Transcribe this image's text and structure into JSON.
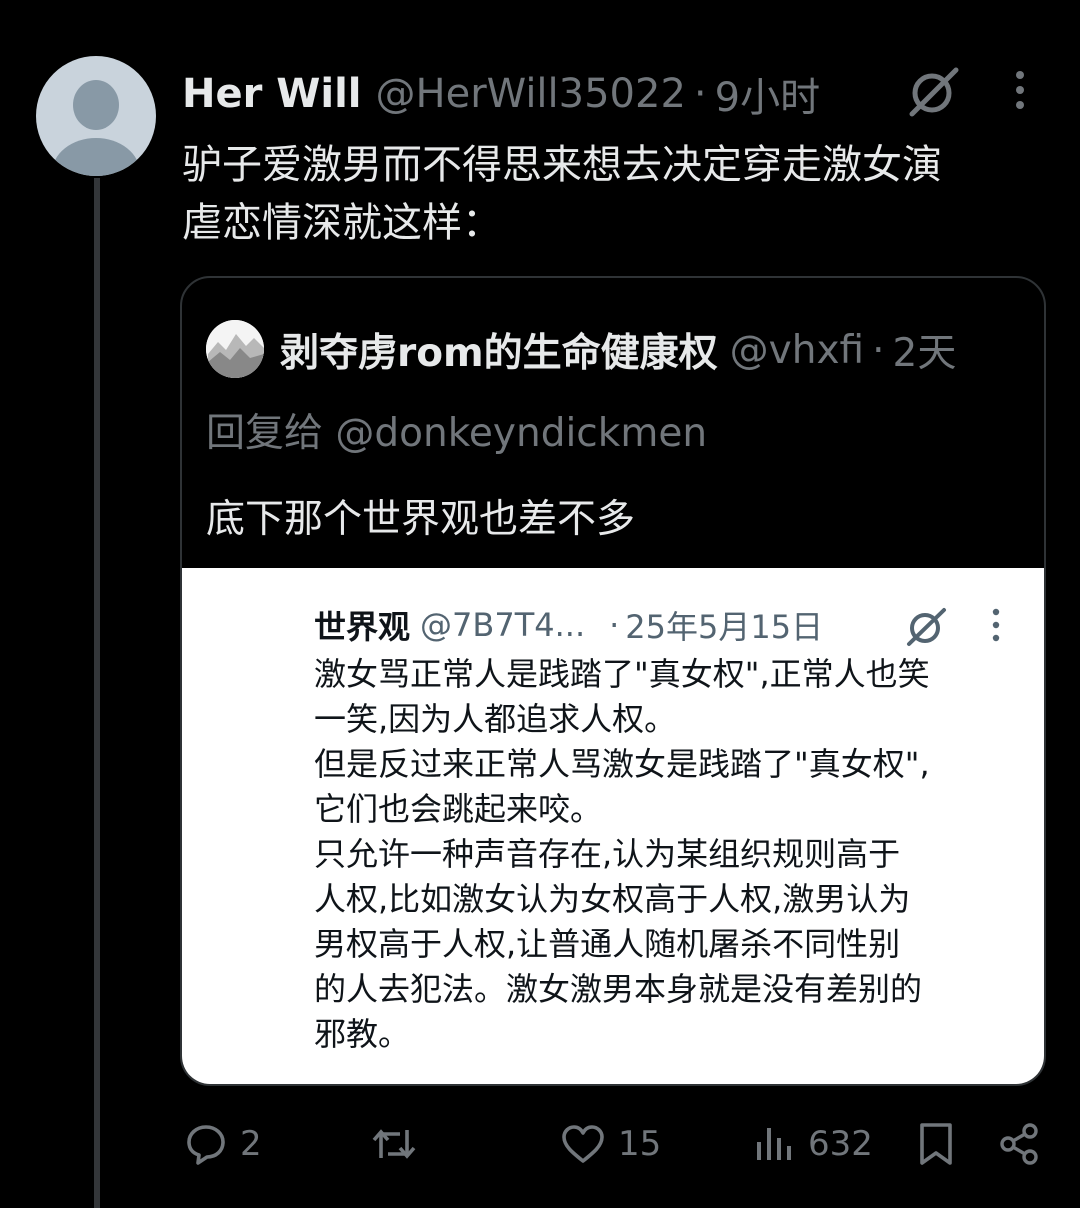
{
  "tweet": {
    "author_name": "Her Will",
    "author_handle": "@HerWill35022",
    "separator": "·",
    "time": "9小时",
    "text_lines": [
      "驴子爱激男而不得思来想去决定穿走激女演",
      "虐恋情深就这样："
    ]
  },
  "quote": {
    "author_name": "剥夺虏rom的生命健康权",
    "author_handle": "@vhxfi",
    "separator": "·",
    "time": "2天",
    "reply_to": "回复给 @donkeyndickmen",
    "text": "底下那个世界观也差不多",
    "embedded_post": {
      "author_name": "世界观",
      "author_handle": "@7B7T4...",
      "separator": "·",
      "date": "25年5月15日",
      "lines": [
        "激女骂正常人是践踏了\"真女权\",正常人也笑",
        "一笑,因为人都追求人权。",
        "但是反过来正常人骂激女是践踏了\"真女权\",",
        "它们也会跳起来咬。",
        "只允许一种声音存在,认为某组织规则高于",
        "人权,比如激女认为女权高于人权,激男认为",
        "男权高于人权,让普通人随机屠杀不同性别",
        "的人去犯法。激女激男本身就是没有差别的",
        "邪教。"
      ]
    }
  },
  "actions": {
    "replies": "2",
    "reposts": "",
    "likes": "15",
    "views": "632"
  },
  "icons": {
    "avatar": "default-avatar-icon",
    "grok": "grok-icon",
    "more": "more-dots-icon",
    "reply": "reply-bubble-icon",
    "repost": "repost-icon",
    "like": "heart-icon",
    "views": "views-bars-icon",
    "bookmark": "bookmark-icon",
    "share": "share-icon"
  },
  "colors": {
    "background": "#000000",
    "primary_text": "#e7e9ea",
    "secondary_text": "#71767b",
    "border": "#2f3336"
  }
}
